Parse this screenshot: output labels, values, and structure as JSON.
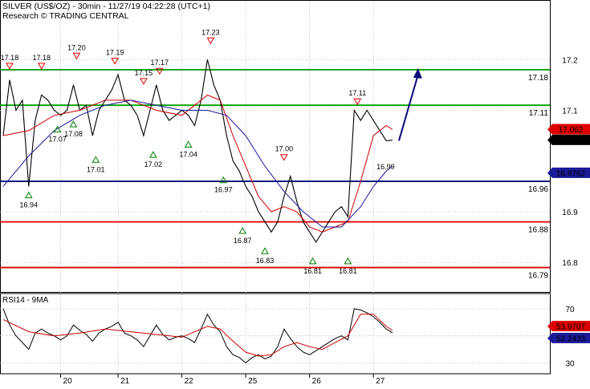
{
  "header": {
    "title": "SILVER (US$/OZ) - 30min - 11/27/19 04:22:28 (UTC+1)",
    "subtitle": "Research © TRADING CENTRAL"
  },
  "chart_data": [
    {
      "type": "line",
      "panel": "price",
      "ylim": [
        16.745,
        17.27
      ],
      "yticks": [
        "17.2",
        "17.1",
        "16.9",
        "16.8"
      ],
      "ytick_values": [
        17.2,
        17.1,
        16.9,
        16.8
      ],
      "xticks": [
        "20",
        "21",
        "22",
        "25",
        "26",
        "27"
      ],
      "xtick_positions": [
        9,
        18,
        28,
        38,
        48,
        58
      ],
      "x_domain": [
        0,
        82
      ],
      "levels": [
        {
          "value": 17.18,
          "label": "17.18",
          "color": "#00a000",
          "label_color": "#00a000"
        },
        {
          "value": 17.11,
          "label": "17.11",
          "color": "#00a000",
          "label_color": "#00a000"
        },
        {
          "value": 16.96,
          "label": "16.96",
          "color": "#0a0a7a",
          "label_color": "#0a0a7a"
        },
        {
          "value": 16.88,
          "label": "16.88",
          "color": "#dd0000",
          "label_color": "#dd0000"
        },
        {
          "value": 16.79,
          "label": "16.79",
          "color": "#dd0000",
          "label_color": "#dd0000"
        }
      ],
      "price_series": {
        "name": "price",
        "x": [
          0,
          1,
          2,
          3,
          4,
          5,
          6,
          7,
          8,
          9,
          10,
          11,
          12,
          13,
          14,
          15,
          16,
          17,
          18,
          19,
          20,
          21,
          22,
          23,
          24,
          25,
          26,
          27,
          28,
          29,
          30,
          31,
          32,
          33,
          34,
          35,
          36,
          37,
          38,
          39,
          40,
          41,
          42,
          43,
          44,
          45,
          46,
          47,
          48,
          49,
          50,
          51,
          52,
          53,
          54,
          55,
          56,
          57,
          58,
          59,
          60,
          61
        ],
        "y": [
          17.05,
          17.16,
          17.1,
          17.12,
          16.95,
          17.08,
          17.13,
          17.12,
          17.1,
          17.09,
          17.1,
          17.15,
          17.1,
          17.11,
          17.05,
          17.1,
          17.12,
          17.14,
          17.17,
          17.12,
          17.11,
          17.09,
          17.05,
          17.1,
          17.15,
          17.1,
          17.08,
          17.09,
          17.1,
          17.09,
          17.07,
          17.12,
          17.2,
          17.15,
          17.12,
          17.05,
          17.0,
          16.98,
          16.95,
          16.93,
          16.9,
          16.88,
          16.86,
          16.88,
          16.93,
          16.97,
          16.92,
          16.88,
          16.86,
          16.84,
          16.86,
          16.88,
          16.9,
          16.91,
          16.89,
          17.1,
          17.08,
          17.1,
          17.08,
          17.06,
          17.04,
          17.041
        ]
      },
      "ma_series": [
        {
          "color": "#cc0000",
          "x": [
            0,
            4,
            8,
            12,
            16,
            20,
            24,
            28,
            32,
            34,
            36,
            38,
            40,
            42,
            44,
            46,
            48,
            50,
            52,
            54,
            56,
            58,
            60,
            61
          ],
          "y": [
            17.05,
            17.06,
            17.09,
            17.1,
            17.12,
            17.12,
            17.1,
            17.09,
            17.13,
            17.12,
            17.05,
            16.99,
            16.93,
            16.9,
            16.91,
            16.9,
            16.87,
            16.86,
            16.87,
            16.88,
            16.96,
            17.05,
            17.07,
            17.062
          ]
        },
        {
          "color": "#1a1a99",
          "x": [
            0,
            4,
            8,
            12,
            16,
            20,
            24,
            28,
            32,
            35,
            38,
            41,
            44,
            47,
            50,
            53,
            56,
            58,
            60,
            61
          ],
          "y": [
            16.95,
            17.01,
            17.06,
            17.09,
            17.11,
            17.12,
            17.11,
            17.1,
            17.1,
            17.09,
            17.05,
            16.99,
            16.94,
            16.9,
            16.87,
            16.87,
            16.91,
            16.95,
            16.98,
            16.99
          ]
        }
      ],
      "forecast_arrow": {
        "from": [
          62,
          17.04
        ],
        "to": [
          65,
          17.18
        ]
      },
      "resistance_markers": [
        {
          "x": 1,
          "value": 17.18,
          "label": "17.18"
        },
        {
          "x": 6,
          "value": 17.18,
          "label": "17.18"
        },
        {
          "x": 11.5,
          "value": 17.2,
          "label": "17.20"
        },
        {
          "x": 17.5,
          "value": 17.19,
          "label": "17.19"
        },
        {
          "x": 22,
          "value": 17.15,
          "label": "17.15"
        },
        {
          "x": 24.5,
          "value": 17.17,
          "label": "17.17"
        },
        {
          "x": 32.5,
          "value": 17.23,
          "label": "17.23"
        },
        {
          "x": 44,
          "value": 17.0,
          "label": "17.00"
        },
        {
          "x": 55.5,
          "value": 17.11,
          "label": "17.11"
        }
      ],
      "support_markers": [
        {
          "x": 4,
          "value": 16.94,
          "label": "16.94"
        },
        {
          "x": 8.5,
          "value": 17.07,
          "label": "17.07"
        },
        {
          "x": 11,
          "value": 17.08,
          "label": "17.08"
        },
        {
          "x": 14.5,
          "value": 17.01,
          "label": "17.01"
        },
        {
          "x": 23.5,
          "value": 17.02,
          "label": "17.02"
        },
        {
          "x": 29,
          "value": 17.04,
          "label": "17.04"
        },
        {
          "x": 34.5,
          "value": 16.97,
          "label": "16.97"
        },
        {
          "x": 37.5,
          "value": 16.87,
          "label": "16.87"
        },
        {
          "x": 41,
          "value": 16.83,
          "label": "16.83"
        },
        {
          "x": 48.5,
          "value": 16.81,
          "label": "16.81"
        },
        {
          "x": 54,
          "value": 16.81,
          "label": "16.81"
        }
      ],
      "extra_labels": [
        {
          "x": 58.5,
          "value": 16.99,
          "text": "16.99",
          "color": "#1a1a99"
        }
      ],
      "tags": [
        {
          "value": 17.062,
          "text": "17.062",
          "bg": "#dd0000",
          "fg": "#ffffff"
        },
        {
          "value": 17.041,
          "text": "17.041",
          "bg": "#000000",
          "fg": "#ffffff"
        },
        {
          "value": 16.976,
          "text": "16.9762",
          "bg": "#1a1a99",
          "fg": "#ffffff"
        }
      ]
    },
    {
      "type": "line",
      "panel": "rsi",
      "title": "RSI14 - 9MA",
      "ylim": [
        22,
        80
      ],
      "yticks": [
        "70",
        "30"
      ],
      "ytick_values": [
        70,
        30
      ],
      "levels": [
        70,
        50,
        30
      ],
      "rsi_series": {
        "x": [
          0,
          1,
          2,
          3,
          4,
          5,
          6,
          7,
          8,
          9,
          10,
          11,
          12,
          13,
          14,
          15,
          16,
          17,
          18,
          19,
          20,
          21,
          22,
          23,
          24,
          25,
          26,
          27,
          28,
          29,
          30,
          31,
          32,
          33,
          34,
          35,
          36,
          37,
          38,
          39,
          40,
          41,
          42,
          43,
          44,
          45,
          46,
          47,
          48,
          49,
          50,
          51,
          52,
          53,
          54,
          55,
          56,
          57,
          58,
          59,
          60,
          61
        ],
        "y": [
          70,
          58,
          50,
          45,
          40,
          52,
          55,
          52,
          50,
          47,
          50,
          58,
          54,
          51,
          46,
          52,
          55,
          57,
          60,
          52,
          50,
          47,
          42,
          50,
          58,
          51,
          47,
          49,
          50,
          48,
          45,
          55,
          66,
          58,
          53,
          42,
          36,
          34,
          30,
          34,
          36,
          33,
          35,
          42,
          55,
          48,
          42,
          38,
          36,
          39,
          42,
          45,
          48,
          50,
          47,
          70,
          69,
          67,
          64,
          60,
          55,
          52.24
        ]
      },
      "ma_series": {
        "x": [
          0,
          4,
          8,
          12,
          16,
          20,
          24,
          28,
          32,
          34,
          36,
          38,
          40,
          42,
          44,
          46,
          48,
          50,
          52,
          54,
          56,
          58,
          60,
          61
        ],
        "y": [
          62,
          53,
          50,
          52,
          55,
          53,
          51,
          49,
          57,
          55,
          46,
          38,
          35,
          36,
          42,
          45,
          42,
          40,
          45,
          50,
          66,
          66,
          57,
          53.97
        ]
      },
      "tags": [
        {
          "value": 53.97,
          "text": "53.9707",
          "bg": "#dd0000",
          "fg": "#ffffff"
        },
        {
          "value": 52.24,
          "text": "52.2433",
          "bg": "#1a1a99",
          "fg": "#ffffff"
        }
      ]
    }
  ]
}
